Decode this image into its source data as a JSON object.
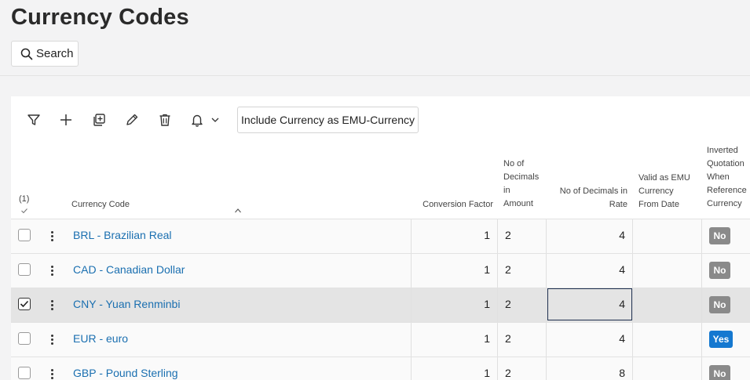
{
  "page": {
    "title": "Currency Codes"
  },
  "search": {
    "label": "Search"
  },
  "toolbar": {
    "include_label": "Include Currency as EMU-Currency"
  },
  "table": {
    "selection_count": "(1)",
    "headers": {
      "currency_code": "Currency Code",
      "conversion_factor": "Conversion Factor",
      "decimals_amount": [
        "No of",
        "Decimals",
        "in",
        "Amount"
      ],
      "decimals_rate": [
        "No of Decimals in",
        "Rate"
      ],
      "valid_emu": [
        "Valid as EMU",
        "Currency",
        "From Date"
      ],
      "inverted": [
        "Inverted",
        "Quotation",
        "When",
        "Reference",
        "Currency"
      ]
    },
    "rows": [
      {
        "code": "BRL - Brazilian Real",
        "factor": "1",
        "dec_amount": "2",
        "dec_rate": "4",
        "emu_date": "",
        "inverted": "No",
        "selected": false
      },
      {
        "code": "CAD - Canadian Dollar",
        "factor": "1",
        "dec_amount": "2",
        "dec_rate": "4",
        "emu_date": "",
        "inverted": "No",
        "selected": false
      },
      {
        "code": "CNY - Yuan Renminbi",
        "factor": "1",
        "dec_amount": "2",
        "dec_rate": "4",
        "emu_date": "",
        "inverted": "No",
        "selected": true
      },
      {
        "code": "EUR - euro",
        "factor": "1",
        "dec_amount": "2",
        "dec_rate": "4",
        "emu_date": "",
        "inverted": "Yes",
        "selected": false
      },
      {
        "code": "GBP - Pound Sterling",
        "factor": "1",
        "dec_amount": "2",
        "dec_rate": "8",
        "emu_date": "",
        "inverted": "No",
        "selected": false
      }
    ]
  },
  "colors": {
    "link": "#1a6fb0",
    "badge_yes": "#1578d0",
    "badge_no": "#8a8a8a",
    "focus_border": "#1e2f4f"
  },
  "icons": [
    "search-icon",
    "filter-icon",
    "plus-icon",
    "duplicate-icon",
    "edit-icon",
    "trash-icon",
    "bell-icon",
    "chevron-down-icon",
    "checkmark-icon",
    "sort-up-icon",
    "kebab-icon"
  ]
}
